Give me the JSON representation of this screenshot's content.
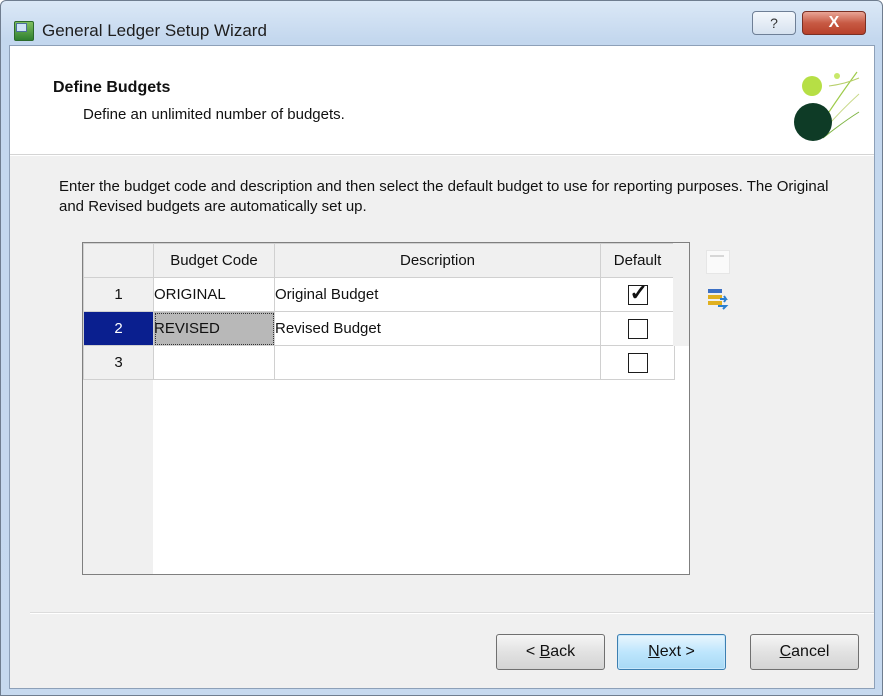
{
  "window": {
    "title": "General Ledger Setup Wizard",
    "help_label": "?",
    "close_label": "X"
  },
  "header": {
    "title": "Define Budgets",
    "subtitle": "Define an unlimited number of budgets."
  },
  "instructions": "Enter the budget code and description and then select the default budget to use for reporting purposes.  The Original and Revised budgets are automatically set up.",
  "grid": {
    "columns": [
      "Budget Code",
      "Description",
      "Default"
    ],
    "rows": [
      {
        "num": "1",
        "code": "ORIGINAL",
        "description": "Original Budget",
        "default": true
      },
      {
        "num": "2",
        "code": "REVISED",
        "description": "Revised Budget",
        "default": false
      },
      {
        "num": "3",
        "code": "",
        "description": "",
        "default": false
      }
    ],
    "selected_row": "2"
  },
  "buttons": {
    "back": {
      "prefix": "< ",
      "mnemonic": "B",
      "rest": "ack"
    },
    "next": {
      "mnemonic": "N",
      "rest": "ext >"
    },
    "cancel": {
      "mnemonic": "C",
      "rest": "ancel"
    }
  },
  "icons": {
    "app": "mas-ledger-icon",
    "side_top": "blank-row-icon",
    "side_bottom": "transfer-list-icon"
  }
}
